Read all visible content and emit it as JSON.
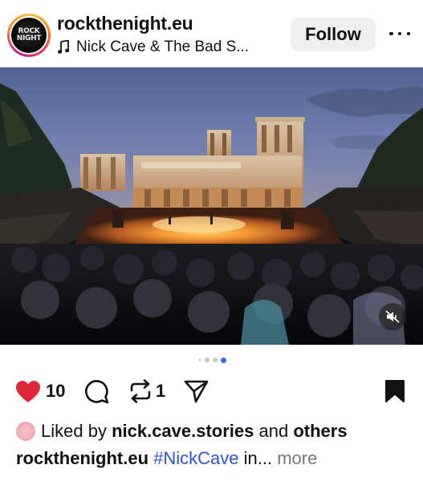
{
  "post": {
    "username": "rockthenight.eu",
    "audio_label": "Nick Cave & The Bad S...",
    "follow_label": "Follow",
    "avatar_logo_lines": [
      "ROCK",
      "NIGHT"
    ],
    "icons": {
      "audio": "music-note-icon",
      "more": "more-options-icon",
      "mute": "volume-muted-icon",
      "like": "heart-filled-icon",
      "comment": "comment-icon",
      "repost": "repost-icon",
      "share": "send-icon",
      "save": "bookmark-filled-icon"
    },
    "colors": {
      "like_red": "#e0283b",
      "hashtag_blue": "#2d51d8",
      "active_dot": "#3e6de0",
      "follow_bg": "#efefef"
    }
  },
  "carousel": {
    "total": 4,
    "active_index": 3
  },
  "actions": {
    "like_count": "10",
    "repost_count": "1"
  },
  "likes": {
    "prefix": "Liked by ",
    "user": "nick.cave.stories",
    "middle": " and ",
    "others": "others"
  },
  "caption": {
    "username": "rockthenight.eu",
    "hashtag": "#NickCave",
    "rest": " in...",
    "more_label": "more"
  }
}
